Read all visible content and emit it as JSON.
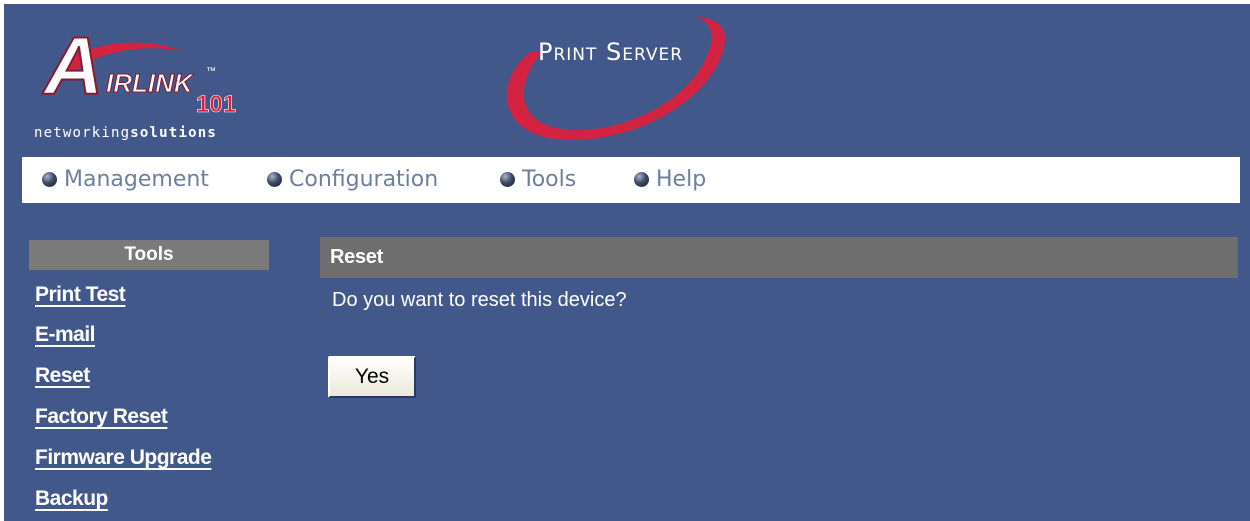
{
  "brand": {
    "logo_letter": "A",
    "logo_text": "IRLINK",
    "logo_tm": "™",
    "logo_number": "101",
    "tagline_light": "networking",
    "tagline_bold": "solutions",
    "product_title": "Print Server"
  },
  "colors": {
    "background": "#43588a",
    "logo_red": "#d42241",
    "nav_text": "#6d7f9e",
    "header_gray": "#6e6e6e"
  },
  "nav": {
    "items": [
      {
        "label": "Management",
        "icon": "bullet-icon"
      },
      {
        "label": "Configuration",
        "icon": "bullet-icon"
      },
      {
        "label": "Tools",
        "icon": "bullet-icon"
      },
      {
        "label": "Help",
        "icon": "bullet-icon"
      }
    ]
  },
  "sidebar": {
    "title": "Tools",
    "links": [
      {
        "label": "Print Test"
      },
      {
        "label": "E-mail"
      },
      {
        "label": "Reset"
      },
      {
        "label": "Factory Reset"
      },
      {
        "label": "Firmware Upgrade"
      },
      {
        "label": "Backup"
      }
    ]
  },
  "main": {
    "title": "Reset",
    "prompt": "Do you want to reset this device?",
    "yes_label": "Yes"
  }
}
